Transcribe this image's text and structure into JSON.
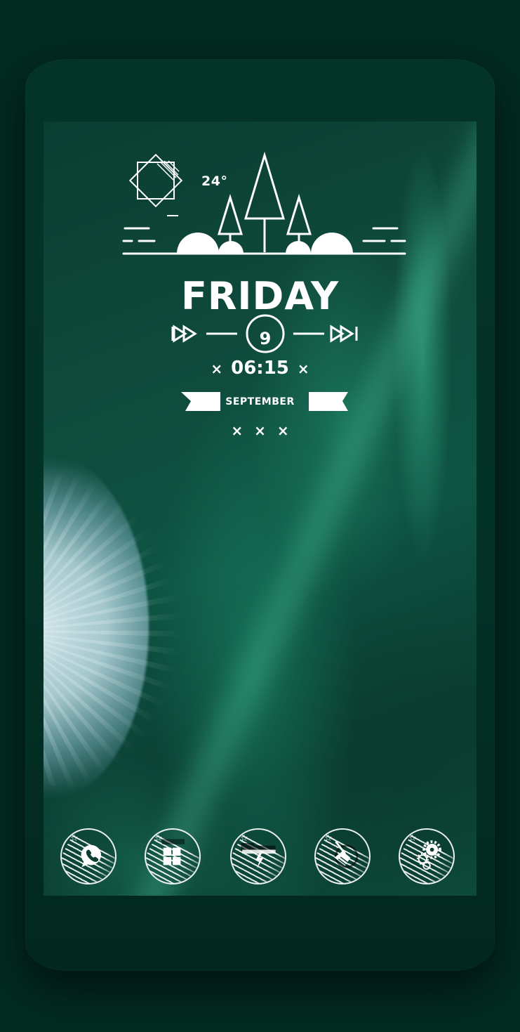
{
  "weather": {
    "temperature": "24°",
    "icon": "sun-outline-icon"
  },
  "clock": {
    "day": "FRIDAY",
    "date": "9",
    "time": "06:15",
    "time_prefix": "×",
    "time_suffix": "×",
    "month": "SEPTEMBER",
    "decoration": "×××"
  },
  "dock": {
    "apps": [
      {
        "name": "phone",
        "icon": "phone-icon"
      },
      {
        "name": "windows",
        "icon": "windows-icon"
      },
      {
        "name": "file-manager",
        "icon": "folder-icon"
      },
      {
        "name": "cleaner",
        "icon": "broom-icon"
      },
      {
        "name": "settings",
        "icon": "gear-icon"
      }
    ]
  },
  "colors": {
    "background": "#022a21",
    "phone_body": "#043428",
    "widget": "#ffffff"
  }
}
